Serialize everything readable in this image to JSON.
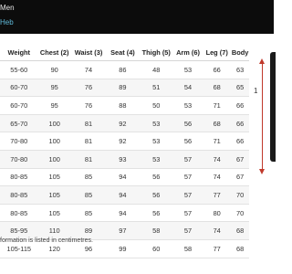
{
  "header": {
    "line1": "Men",
    "line2": "Heb"
  },
  "table": {
    "headers": [
      "Weight",
      "Chest (2)",
      "Waist (3)",
      "Seat (4)",
      "Thigh (5)",
      "Arm (6)",
      "Leg (7)",
      "Body"
    ],
    "rows": [
      [
        "55-60",
        "90",
        "74",
        "86",
        "48",
        "53",
        "66",
        "63"
      ],
      [
        "60-70",
        "95",
        "76",
        "89",
        "51",
        "54",
        "68",
        "65"
      ],
      [
        "60-70",
        "95",
        "76",
        "88",
        "50",
        "53",
        "71",
        "66"
      ],
      [
        "65-70",
        "100",
        "81",
        "92",
        "53",
        "56",
        "68",
        "66"
      ],
      [
        "70-80",
        "100",
        "81",
        "92",
        "53",
        "56",
        "71",
        "66"
      ],
      [
        "70-80",
        "100",
        "81",
        "93",
        "53",
        "57",
        "74",
        "67"
      ],
      [
        "80-85",
        "105",
        "85",
        "94",
        "56",
        "57",
        "74",
        "67"
      ],
      [
        "80-85",
        "105",
        "85",
        "94",
        "56",
        "57",
        "77",
        "70"
      ],
      [
        "80-85",
        "105",
        "85",
        "94",
        "56",
        "57",
        "80",
        "70"
      ],
      [
        "85-95",
        "110",
        "89",
        "97",
        "58",
        "57",
        "74",
        "68"
      ],
      [
        "105-115",
        "120",
        "96",
        "99",
        "60",
        "58",
        "77",
        "68"
      ]
    ]
  },
  "note": "formation is listed in centimetres.",
  "figure": {
    "measure_label": "1",
    "arrow_color": "#c0392b"
  }
}
